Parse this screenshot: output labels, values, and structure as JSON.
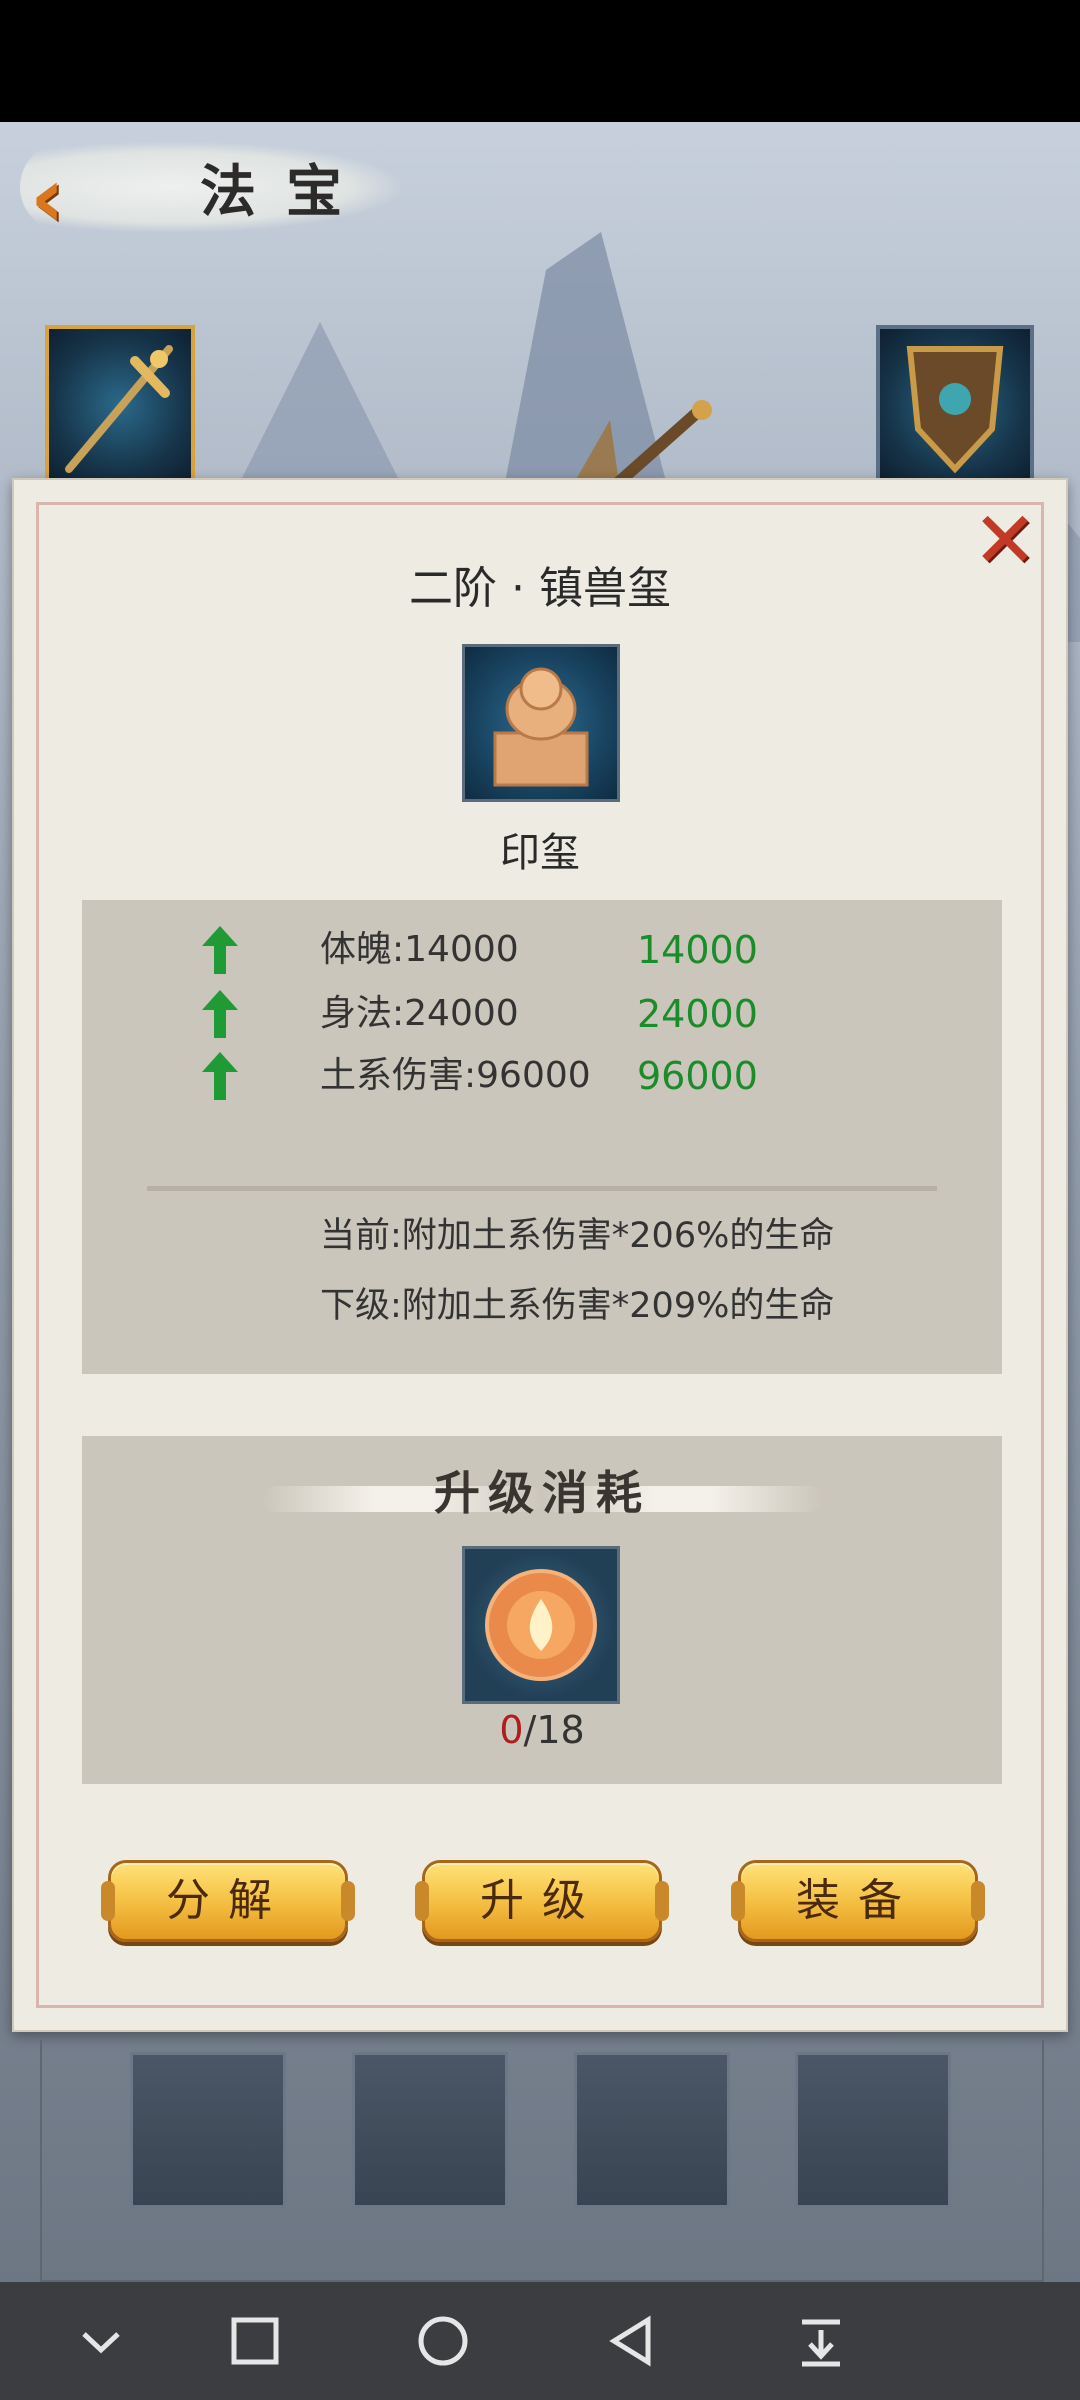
{
  "header": {
    "title": "法宝"
  },
  "item": {
    "title": "二阶 · 镇兽玺",
    "type": "印玺",
    "stats": [
      {
        "label": "体魄:14000",
        "next": "14000"
      },
      {
        "label": "身法:24000",
        "next": "24000"
      },
      {
        "label": "土系伤害:96000",
        "next": "96000"
      }
    ],
    "effect_current": "当前:附加土系伤害*206%的生命",
    "effect_next": "下级:附加土系伤害*209%的生命"
  },
  "cost": {
    "title": "升级消耗",
    "have": "0",
    "need": "/18"
  },
  "buttons": {
    "decompose": "分解",
    "upgrade": "升级",
    "equip": "装备"
  },
  "colors": {
    "stat_green": "#1a8c2a",
    "deficit_red": "#b01d1d",
    "button_gold": "#f6c448",
    "close_red": "#c23a25"
  },
  "icons": {
    "back": "back-arrow-icon",
    "close": "close-x-icon",
    "stat_up": "up-arrow-icon",
    "nav": [
      "chevron-down-icon",
      "square-icon",
      "circle-icon",
      "triangle-back-icon",
      "download-lines-icon"
    ]
  }
}
